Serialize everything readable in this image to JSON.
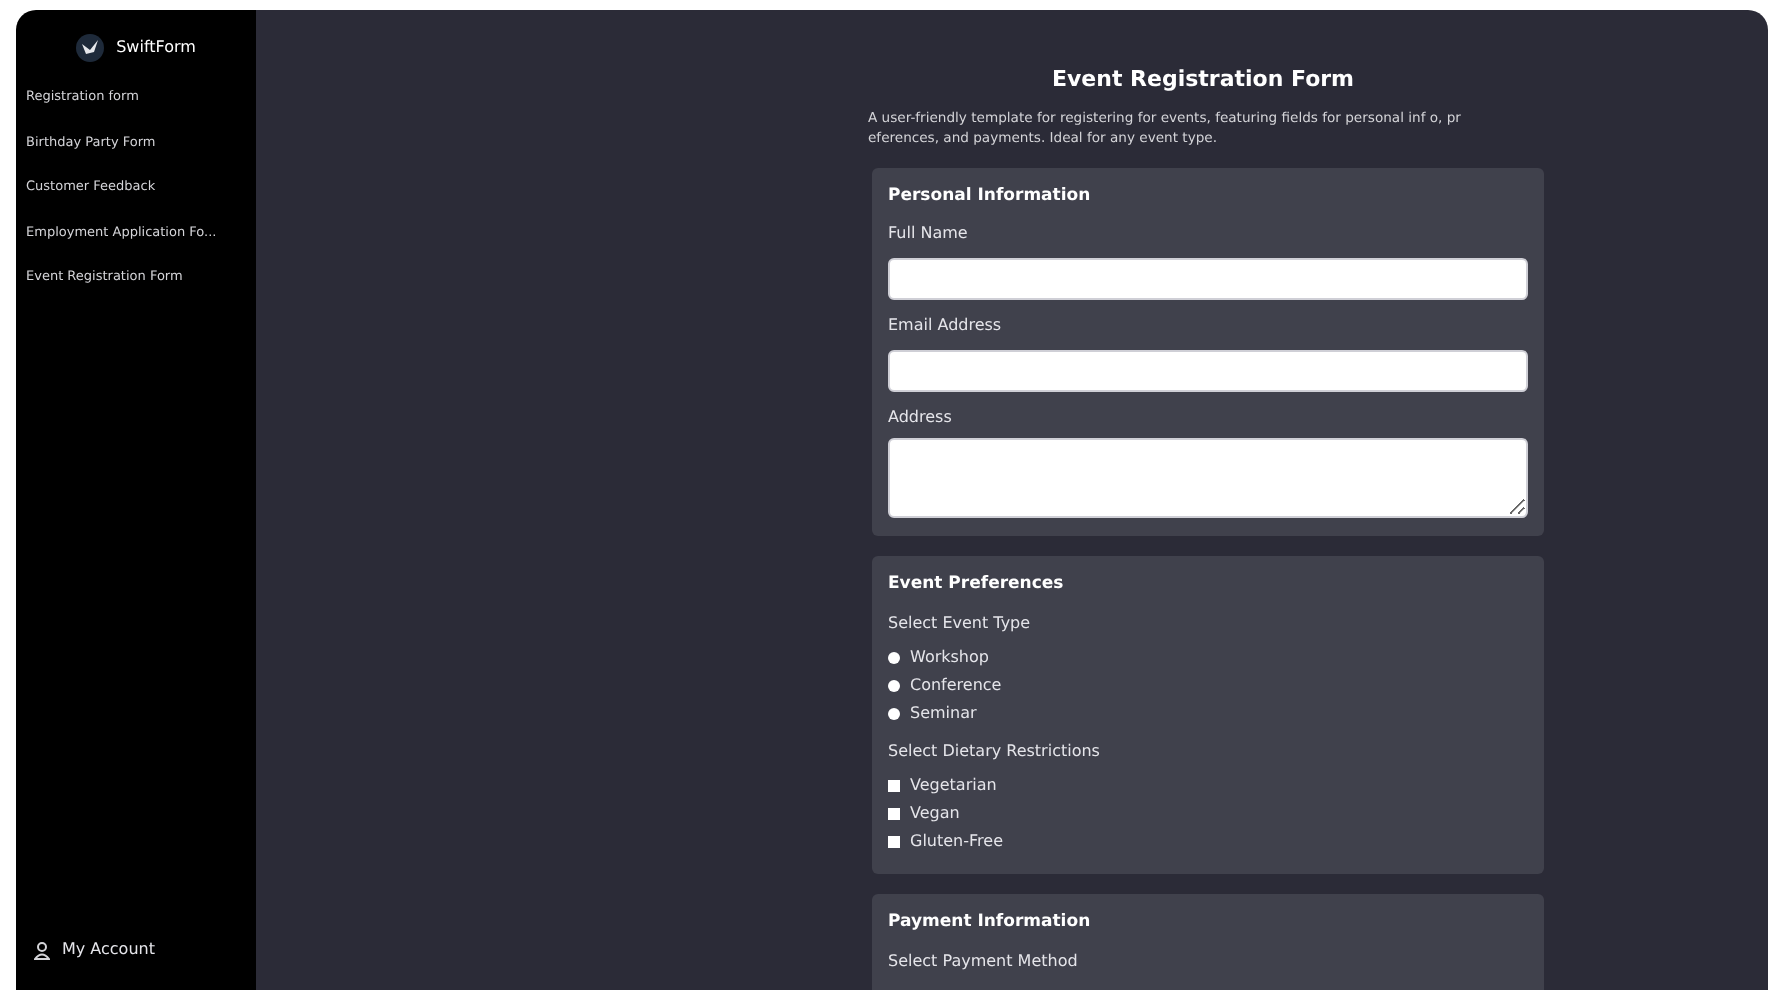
{
  "sidebar": {
    "brand": "SwiftForm",
    "items": [
      {
        "label": "Registration form"
      },
      {
        "label": "Birthday Party Form"
      },
      {
        "label": "Customer Feedback"
      },
      {
        "label": "Employment Application Fo..."
      },
      {
        "label": "Event Registration Form"
      }
    ],
    "account": "My Account"
  },
  "form": {
    "title": "Event Registration Form",
    "description": "A user-friendly template for registering for events, featuring fields for personal inf o, preferences, and payments. Ideal for any event type.",
    "sections": [
      {
        "title": "Personal Information",
        "fields": [
          {
            "kind": "text",
            "label": "Full Name"
          },
          {
            "kind": "text",
            "label": "Email Address"
          },
          {
            "kind": "textarea",
            "label": "Address"
          }
        ]
      },
      {
        "title": "Event Preferences",
        "fields": [
          {
            "kind": "radio",
            "label": "Select Event Type",
            "options": [
              {
                "label": "Workshop",
                "selected": false
              },
              {
                "label": "Conference",
                "selected": false
              },
              {
                "label": "Seminar",
                "selected": false
              }
            ]
          },
          {
            "kind": "checkbox",
            "label": "Select Dietary Restrictions",
            "options": [
              {
                "label": "Vegetarian",
                "checked": false
              },
              {
                "label": "Vegan",
                "checked": false
              },
              {
                "label": "Gluten-Free",
                "checked": false
              }
            ]
          }
        ]
      },
      {
        "title": "Payment Information",
        "fields": [
          {
            "kind": "label",
            "label": "Select Payment Method"
          }
        ]
      }
    ]
  }
}
